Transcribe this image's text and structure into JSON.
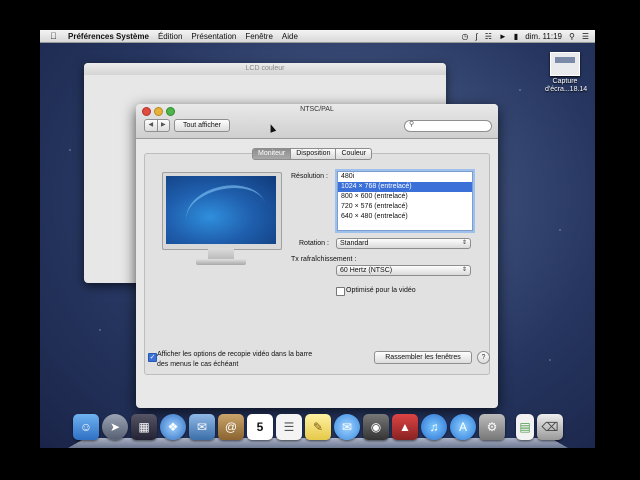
{
  "menubar": {
    "app": "Préférences Système",
    "items": [
      "Édition",
      "Présentation",
      "Fenêtre",
      "Aide"
    ],
    "clock": "dim. 11:19"
  },
  "desktop": {
    "file_icon_line1": "Capture",
    "file_icon_line2": "d'écra...18.14"
  },
  "back_window": {
    "title": "LCD couleur"
  },
  "window": {
    "title": "NTSC/PAL",
    "show_all": "Tout afficher",
    "search_placeholder": "",
    "tabs": [
      {
        "label": "Moniteur",
        "active": true
      },
      {
        "label": "Disposition",
        "active": false
      },
      {
        "label": "Couleur",
        "active": false
      }
    ],
    "resolution_label": "Résolution :",
    "resolutions": [
      {
        "label": "480i",
        "selected": false
      },
      {
        "label": "1024 × 768 (entrelacé)",
        "selected": true
      },
      {
        "label": "800 × 600 (entrelacé)",
        "selected": false
      },
      {
        "label": "720 × 576 (entrelacé)",
        "selected": false
      },
      {
        "label": "640 × 480 (entrelacé)",
        "selected": false
      }
    ],
    "rotation_label": "Rotation :",
    "rotation_value": "Standard",
    "refresh_label": "Tx rafraîchissement :",
    "refresh_value": "60 Hertz (NTSC)",
    "overscan_label": "Optimisé pour la vidéo",
    "overscan_checked": false,
    "mirror_line1": "Afficher les options de recopie vidéo dans la barre",
    "mirror_line2": "des menus le cas échéant",
    "mirror_checked": true,
    "gather_button": "Rassembler les fenêtres",
    "help_label": "?"
  },
  "dock": {
    "apps": [
      "finder-icon",
      "launchpad-icon",
      "mission-control-icon",
      "safari-icon",
      "mail-icon",
      "contacts-icon",
      "calendar-icon",
      "reminders-icon",
      "notes-icon",
      "messages-icon",
      "facetime-icon",
      "photo-booth-icon",
      "itunes-icon",
      "app-store-icon",
      "system-preferences-icon",
      "document-icon",
      "trash-icon"
    ],
    "calendar_day": "5"
  }
}
